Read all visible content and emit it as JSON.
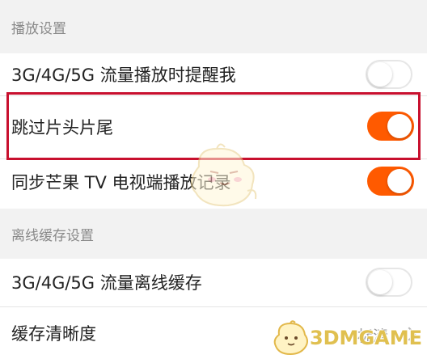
{
  "sections": {
    "playback": {
      "title": "播放设置",
      "items": [
        {
          "label": "3G/4G/5G 流量播放时提醒我",
          "toggle": "off"
        },
        {
          "label": "跳过片头片尾",
          "toggle": "on"
        },
        {
          "label": "同步芒果 TV 电视端播放记录",
          "toggle": "on"
        }
      ]
    },
    "offline_cache": {
      "title": "离线缓存设置",
      "items": [
        {
          "label": "3G/4G/5G 流量离线缓存",
          "toggle": "off"
        },
        {
          "label": "缓存清晰度",
          "value": "标清"
        }
      ]
    }
  },
  "colors": {
    "toggle_on": "#ff5a00",
    "highlight_border": "#c8102e"
  },
  "watermark": {
    "text": "3DMGAME",
    "icon": "mascot-icon"
  }
}
